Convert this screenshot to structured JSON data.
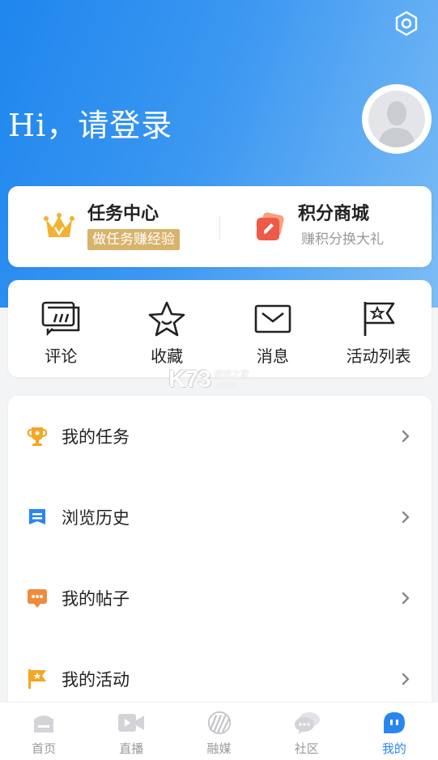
{
  "header": {
    "greeting": "Hi，请登录"
  },
  "promos": [
    {
      "title": "任务中心",
      "subtitle": "做任务赚经验",
      "icon": "crown-icon"
    },
    {
      "title": "积分商城",
      "subtitle": "赚积分换大礼",
      "icon": "points-icon"
    }
  ],
  "quick": [
    {
      "label": "评论",
      "icon": "comment-icon"
    },
    {
      "label": "收藏",
      "icon": "star-icon"
    },
    {
      "label": "消息",
      "icon": "mail-icon"
    },
    {
      "label": "活动列表",
      "icon": "flag-star-icon"
    }
  ],
  "watermark": {
    "logo": "K73",
    "line1": "游戏之家",
    "line2": ".com"
  },
  "menu": [
    {
      "label": "我的任务",
      "icon": "trophy-icon"
    },
    {
      "label": "浏览历史",
      "icon": "history-icon"
    },
    {
      "label": "我的帖子",
      "icon": "post-icon"
    },
    {
      "label": "我的活动",
      "icon": "activity-flag-icon"
    }
  ],
  "tabs": [
    {
      "label": "首页",
      "icon": "home-icon",
      "active": false
    },
    {
      "label": "直播",
      "icon": "video-icon",
      "active": false
    },
    {
      "label": "融媒",
      "icon": "media-icon",
      "active": false
    },
    {
      "label": "社区",
      "icon": "community-icon",
      "active": false
    },
    {
      "label": "我的",
      "icon": "mine-icon",
      "active": true
    }
  ],
  "colors": {
    "brand": "#2a86ee",
    "badge": "#d8b36a",
    "accentOrange": "#f08a3c"
  }
}
